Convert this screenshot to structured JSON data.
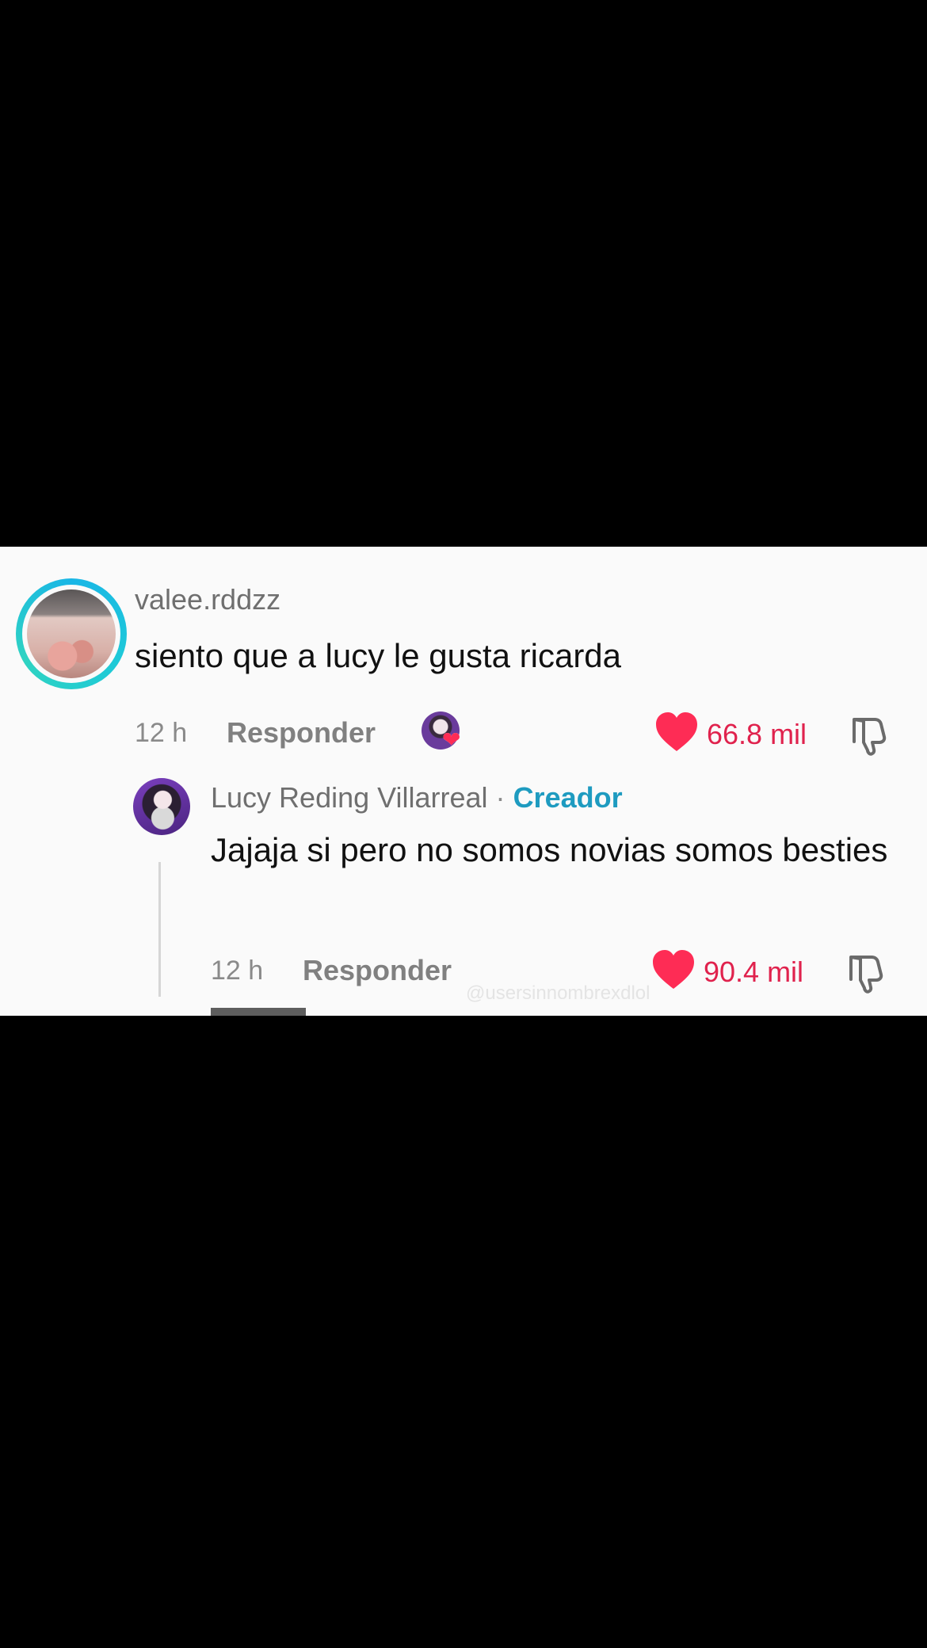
{
  "colors": {
    "background": "#000000",
    "panel": "#fafafa",
    "like_red": "#fe2c55",
    "creator_blue": "#1e9bc0",
    "story_ring": "#19b6e6"
  },
  "comment": {
    "username": "valee.rddzz",
    "text": "siento que a lucy le gusta ricarda",
    "time": "12 h",
    "reply_label": "Responder",
    "likes": "66.8 mil",
    "icons": {
      "like": "heart-icon",
      "dislike": "thumbs-down-icon",
      "creator_liked": "creator-liked-heart-icon"
    }
  },
  "reply": {
    "author": "Lucy Reding Villarreal",
    "separator": "·",
    "creator_tag": "Creador",
    "text": "Jajaja si pero no somos novias somos besties",
    "time": "12 h",
    "reply_label": "Responder",
    "likes": "90.4 mil"
  },
  "watermark": "@usersinnombrexdlol"
}
